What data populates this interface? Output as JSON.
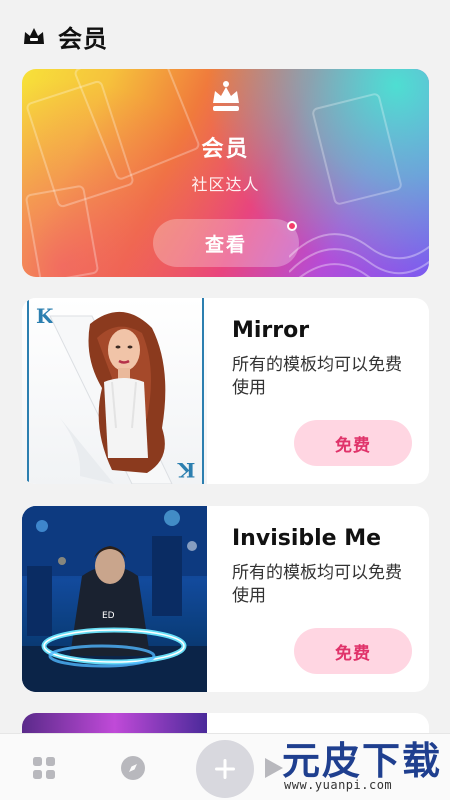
{
  "header": {
    "title": "会员",
    "icon": "crown-icon"
  },
  "banner": {
    "icon": "crown-icon",
    "title": "会员",
    "subtitle": "社区达人",
    "button_label": "查看",
    "notification_dot_color": "#f43d6b"
  },
  "cards": [
    {
      "title": "Mirror",
      "description": "所有的模板均可以免费使用",
      "button_label": "免费"
    },
    {
      "title": "Invisible Me",
      "description": "所有的模板均可以免费使用",
      "button_label": "免费"
    }
  ],
  "bottom_nav": {
    "items": [
      {
        "icon": "grid-icon"
      },
      {
        "icon": "compass-icon"
      },
      {
        "icon": "plus-icon"
      },
      {
        "icon": "play-icon"
      }
    ]
  },
  "watermark": {
    "logo": "元皮下载",
    "url": "www.yuanpi.com"
  },
  "colors": {
    "accent_pink": "#e0336a",
    "free_button_bg": "#ffd6e2",
    "background": "#f2f2f2"
  }
}
